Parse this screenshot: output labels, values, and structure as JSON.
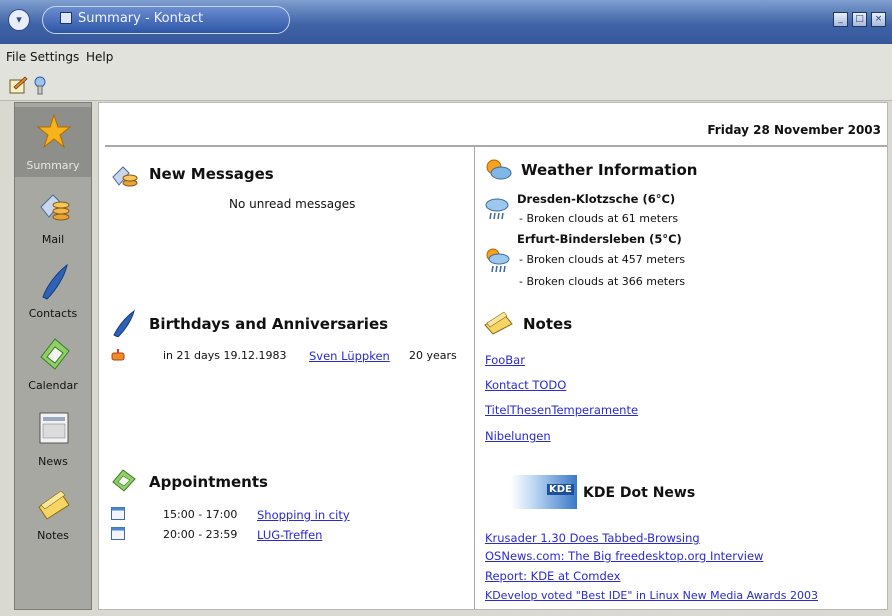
{
  "window": {
    "title": "Summary - Kontact"
  },
  "menu": [
    "File",
    "Settings",
    "Help"
  ],
  "sidebar": [
    {
      "label": "Summary"
    },
    {
      "label": "Mail"
    },
    {
      "label": "Contacts"
    },
    {
      "label": "Calendar"
    },
    {
      "label": "News"
    },
    {
      "label": "Notes"
    }
  ],
  "summary": {
    "date": "Friday 28 November 2003",
    "messages": {
      "title": "New Messages",
      "status": "No unread messages"
    },
    "birthdays": {
      "title": "Birthdays and Anniversaries",
      "entry_prefix": "in 21 days 19.12.1983",
      "entry_name": "Sven Lüppken",
      "entry_suffix": "20 years"
    },
    "appointments": {
      "title": "Appointments",
      "items": [
        {
          "time": "15:00 - 17:00",
          "title": "Shopping in city"
        },
        {
          "time": "20:00 - 23:59",
          "title": "LUG-Treffen"
        }
      ]
    },
    "weather": {
      "title": "Weather Information",
      "stations": [
        {
          "name": "Dresden-Klotzsche (6°C)",
          "lines": [
            "- Broken clouds at 61 meters"
          ]
        },
        {
          "name": "Erfurt-Bindersleben (5°C)",
          "lines": [
            "- Broken clouds at 457 meters",
            "- Broken clouds at 366 meters"
          ]
        }
      ]
    },
    "notes": {
      "title": "Notes",
      "items": [
        "FooBar",
        "Kontact TODO",
        "TitelThesenTemperamente",
        "Nibelungen"
      ]
    },
    "news": {
      "title": "KDE Dot News",
      "logo_text": "KDE",
      "items": [
        "Krusader 1.30 Does Tabbed-Browsing",
        "OSNews.com: The Big freedesktop.org Interview",
        "Report: KDE at Comdex",
        "KDevelop voted \"Best IDE\" in Linux New Media Awards 2003"
      ]
    }
  }
}
